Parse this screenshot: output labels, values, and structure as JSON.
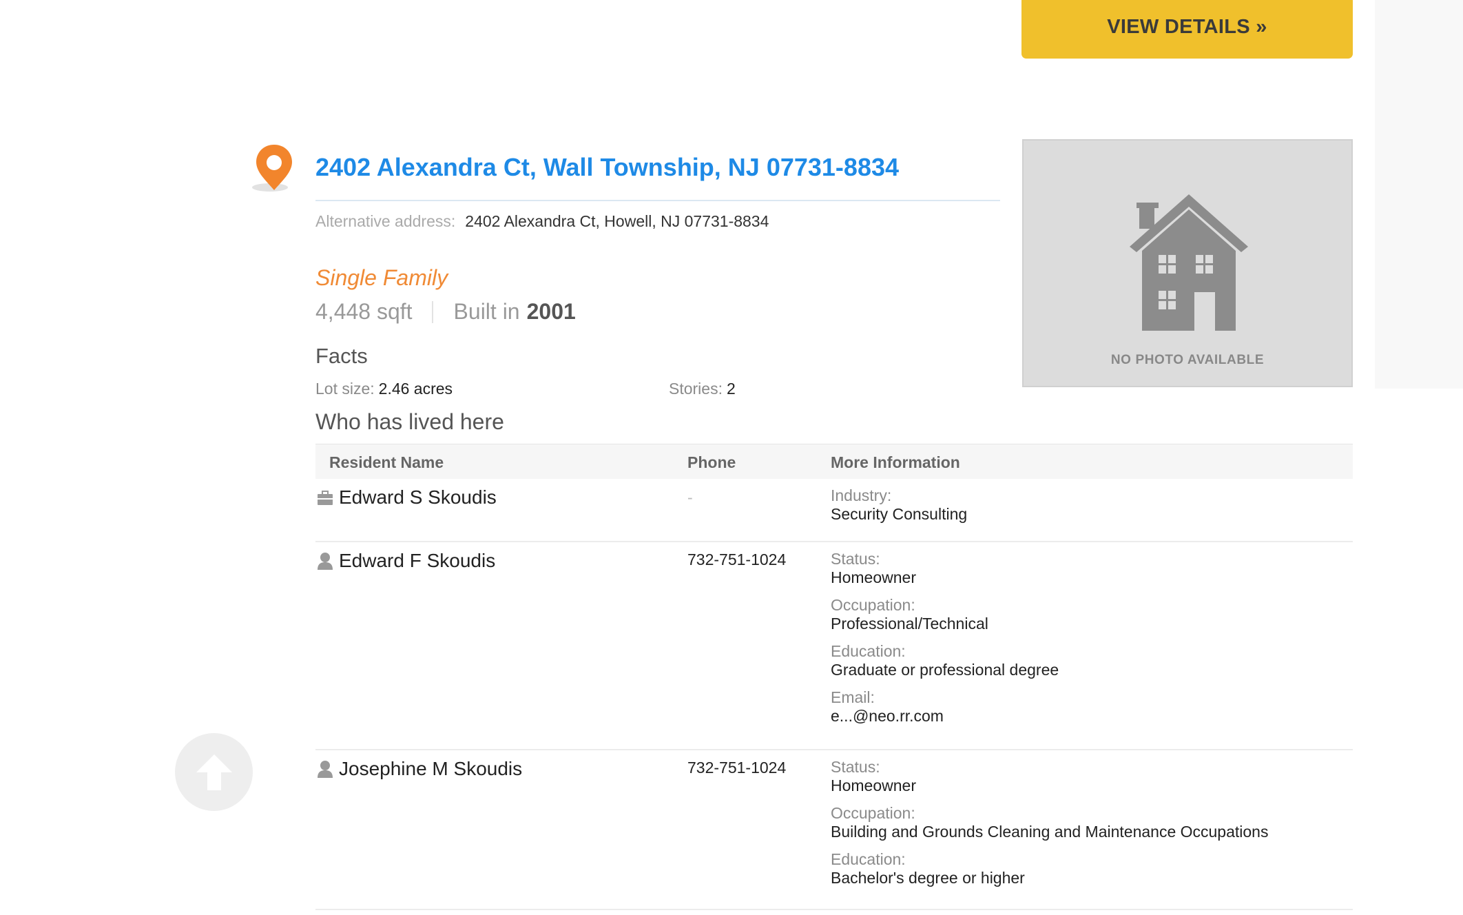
{
  "header": {
    "view_details_label": "VIEW DETAILS »"
  },
  "property": {
    "address": "2402 Alexandra Ct, Wall Township, NJ 07731-8834",
    "alt_label": "Alternative address:",
    "alt_value": "2402 Alexandra Ct, Howell, NJ 07731-8834",
    "type": "Single Family",
    "sqft": "4,448 sqft",
    "built_label": "Built in",
    "built_year": "2001",
    "no_photo": "NO PHOTO AVAILABLE"
  },
  "facts": {
    "title": "Facts",
    "lot_label": "Lot size:",
    "lot_value": "2.46 acres",
    "stories_label": "Stories:",
    "stories_value": "2"
  },
  "residents": {
    "title": "Who has lived here",
    "columns": {
      "name": "Resident Name",
      "phone": "Phone",
      "info": "More Information"
    },
    "rows": [
      {
        "icon": "briefcase-icon",
        "name": "Edward S Skoudis",
        "phone": "-",
        "info": [
          {
            "label": "Industry:",
            "value": "Security Consulting"
          }
        ]
      },
      {
        "icon": "person-icon",
        "name": "Edward F Skoudis",
        "phone": "732-751-1024",
        "info": [
          {
            "label": "Status:",
            "value": "Homeowner"
          },
          {
            "label": "Occupation:",
            "value": "Professional/Technical"
          },
          {
            "label": "Education:",
            "value": "Graduate or professional degree"
          },
          {
            "label": "Email:",
            "value": "e...@neo.rr.com"
          }
        ]
      },
      {
        "icon": "person-icon",
        "name": "Josephine M Skoudis",
        "phone": "732-751-1024",
        "info": [
          {
            "label": "Status:",
            "value": "Homeowner"
          },
          {
            "label": "Occupation:",
            "value": "Building and Grounds Cleaning and Maintenance Occupations"
          },
          {
            "label": "Education:",
            "value": "Bachelor's degree or higher"
          }
        ]
      }
    ]
  },
  "colors": {
    "accent_yellow": "#f0c02c",
    "link_blue": "#1e8ae6",
    "orange": "#f08a35"
  },
  "icons": {
    "pin": "map-pin-icon",
    "house": "house-icon",
    "back_to_top": "arrow-up-icon"
  }
}
